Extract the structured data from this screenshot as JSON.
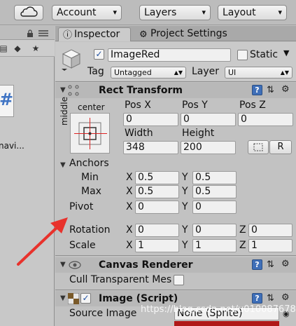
{
  "toolbar": {
    "cloud_icon": "cloud-icon",
    "account_label": "Account",
    "layers_label": "Layers",
    "layout_label": "Layout",
    "caret": "▾"
  },
  "left_panel": {
    "lock_icon": "lock-icon",
    "menu_icon": "menu-icon",
    "tools": [
      "filter-icon",
      "tag-icon",
      "star-icon"
    ],
    "asset_glyph": "#",
    "asset_label": "navi..."
  },
  "inspector": {
    "tabs": [
      {
        "label": "Inspector",
        "icon": "info-icon"
      },
      {
        "label": "Project Settings",
        "icon": "gear-icon"
      }
    ],
    "object": {
      "name": "ImageRed",
      "active": true,
      "static_label": "Static",
      "tag_label": "Tag",
      "tag_value": "Untagged",
      "layer_label": "Layer",
      "layer_value": "UI"
    },
    "rect_transform": {
      "title": "Rect Transform",
      "anchor_top_label": "center",
      "anchor_side_label": "middle",
      "pos_labels": [
        "Pos X",
        "Pos Y",
        "Pos Z"
      ],
      "pos_values": [
        "0",
        "0",
        "0"
      ],
      "width_label": "Width",
      "height_label": "Height",
      "width_value": "348",
      "height_value": "200",
      "raw_button": "R",
      "anchors_label": "Anchors",
      "min_label": "Min",
      "max_label": "Max",
      "min_x": "0.5",
      "min_y": "0.5",
      "max_x": "0.5",
      "max_y": "0.5",
      "pivot_label": "Pivot",
      "pivot_x": "0",
      "pivot_y": "0",
      "rotation_label": "Rotation",
      "rotation": [
        "0",
        "0",
        "0"
      ],
      "scale_label": "Scale",
      "scale": [
        "1",
        "1",
        "1"
      ],
      "axis_x": "X",
      "axis_y": "Y",
      "axis_z": "Z"
    },
    "canvas_renderer": {
      "title": "Canvas Renderer",
      "cull_label": "Cull Transparent Mes"
    },
    "image": {
      "title": "Image (Script)",
      "enabled": true,
      "source_label": "Source Image",
      "source_value": "None (Sprite)"
    },
    "help_glyph": "?",
    "settings_glyph": "⚙",
    "check_glyph": "✓"
  },
  "watermark": "https://blog.csdn.net/u010087678",
  "colors": {
    "arrow": "#e8322c",
    "help_button": "#3f6fb8",
    "panel_bg": "#c2c2c2"
  }
}
